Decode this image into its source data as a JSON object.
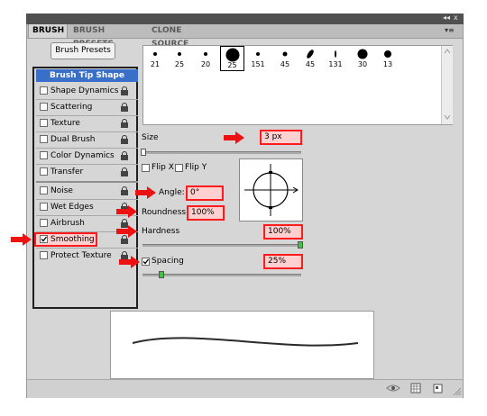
{
  "panel": {
    "tabs": [
      {
        "label": "BRUSH",
        "active": true
      },
      {
        "label": "BRUSH PRESETS",
        "active": false
      },
      {
        "label": "CLONE SOURCE",
        "active": false
      }
    ],
    "topbar_controls": {
      "collapse": "◂◂",
      "close": "x",
      "menu": "▾≡"
    }
  },
  "brush_presets_button": "Brush Presets",
  "sidebar": {
    "selected": "Brush Tip Shape",
    "items": [
      {
        "label": "Shape Dynamics",
        "checked": false
      },
      {
        "label": "Scattering",
        "checked": false
      },
      {
        "label": "Texture",
        "checked": false
      },
      {
        "label": "Dual Brush",
        "checked": false
      },
      {
        "label": "Color Dynamics",
        "checked": false
      },
      {
        "label": "Transfer",
        "checked": false
      },
      {
        "label": "Noise",
        "checked": false
      },
      {
        "label": "Wet Edges",
        "checked": false
      },
      {
        "label": "Airbrush",
        "checked": false
      },
      {
        "label": "Smoothing",
        "checked": true
      },
      {
        "label": "Protect Texture",
        "checked": false
      }
    ]
  },
  "brushes": [
    "21",
    "25",
    "20",
    "25",
    "151",
    "45",
    "45",
    "131",
    "30",
    "13"
  ],
  "controls": {
    "size_label": "Size",
    "size_value": "3 px",
    "flip_x": "Flip X",
    "flip_y": "Flip Y",
    "angle_label": "Angle:",
    "angle_value": "0°",
    "roundness_label": "Roundness:",
    "roundness_value": "100%",
    "hardness_label": "Hardness",
    "hardness_value": "100%",
    "spacing_label": "Spacing",
    "spacing_value": "25%",
    "spacing_checked": true
  },
  "colors": {
    "highlight": "#ff1b1b",
    "selection": "#3a6fc9",
    "arrow": "#ee1111"
  }
}
